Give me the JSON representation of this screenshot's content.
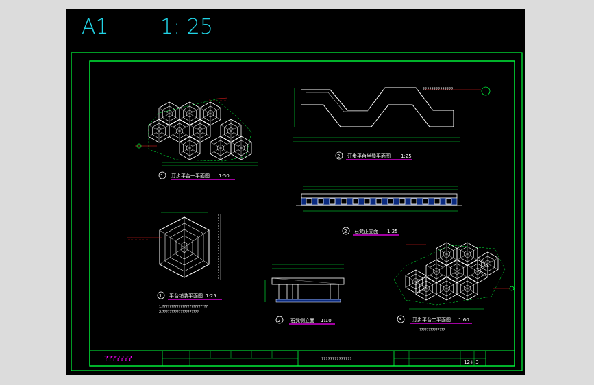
{
  "header": {
    "sheet_size": "A1",
    "scale": "1: 25"
  },
  "drawings": [
    {
      "number": "1",
      "title": "汀步平台一平面图",
      "scale": "1:50"
    },
    {
      "number": "2",
      "title": "汀步平台坐凳平面图",
      "scale": "1:25"
    },
    {
      "number": "2",
      "title": "石凳正立面",
      "scale": "1:25"
    },
    {
      "number": "1",
      "title": "平台铺装平面图",
      "scale": "1:25"
    },
    {
      "number": "2",
      "title": "石凳侧立面",
      "scale": "1:10"
    },
    {
      "number": "3",
      "title": "汀步平台二平面图",
      "scale": "1:60"
    }
  ],
  "annotations": {
    "bench_callout": "??????????????",
    "paving_note_1": "1.?????????????????????????",
    "paving_note_2": "2.????????????????????",
    "platform2_note": "??????????????"
  },
  "title_block": {
    "company": "???????",
    "drawing_name": "??????????????",
    "drawing_no": "12+-3"
  },
  "colors": {
    "line": "#00ff3c",
    "text": "#ffffff",
    "accent": "#ff2020",
    "underline": "#ff00ff",
    "frame_text": "#21d4e6"
  }
}
